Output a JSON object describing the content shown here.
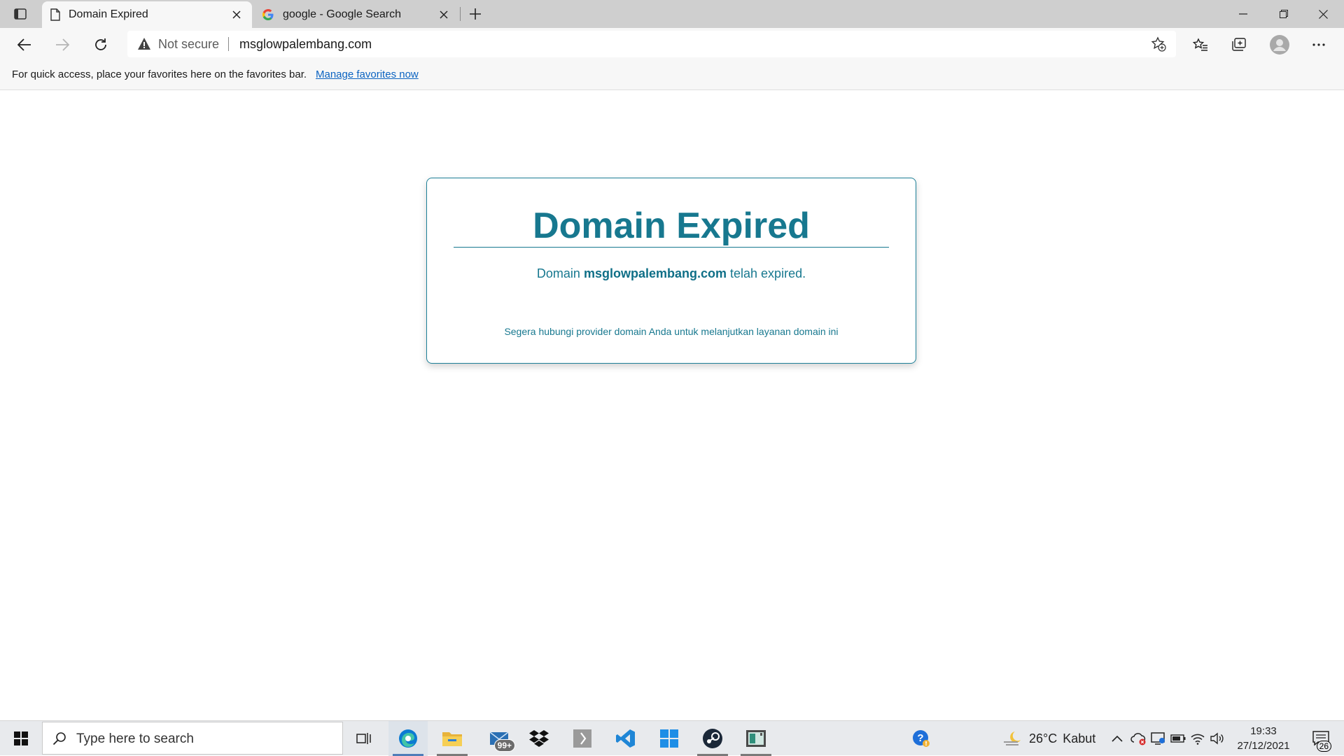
{
  "browser": {
    "tabs": [
      {
        "title": "Domain Expired",
        "active": true,
        "icon": "page-icon"
      },
      {
        "title": "google - Google Search",
        "active": false,
        "icon": "google-icon"
      }
    ],
    "address": {
      "security_text": "Not secure",
      "url": "msglowpalembang.com"
    },
    "favorites_bar": {
      "message": "For quick access, place your favorites here on the favorites bar.",
      "link": "Manage favorites now"
    }
  },
  "page": {
    "title": "Domain Expired",
    "message_prefix": "Domain",
    "domain": "msglowpalembang.com",
    "message_suffix": "telah expired.",
    "note": "Segera hubungi provider domain Anda untuk melanjutkan layanan domain ini"
  },
  "taskbar": {
    "search_placeholder": "Type here to search",
    "mail_badge": "99+",
    "weather": {
      "temp": "26°C",
      "condition": "Kabut"
    },
    "time": "19:33",
    "date": "27/12/2021",
    "notification_count": "26",
    "apps": [
      "task-view",
      "edge",
      "file-explorer",
      "mail",
      "dropbox",
      "app-s",
      "vscode",
      "windows-store",
      "steam",
      "app-window"
    ]
  },
  "colors": {
    "accent": "#17788f",
    "link": "#0b63c1"
  }
}
